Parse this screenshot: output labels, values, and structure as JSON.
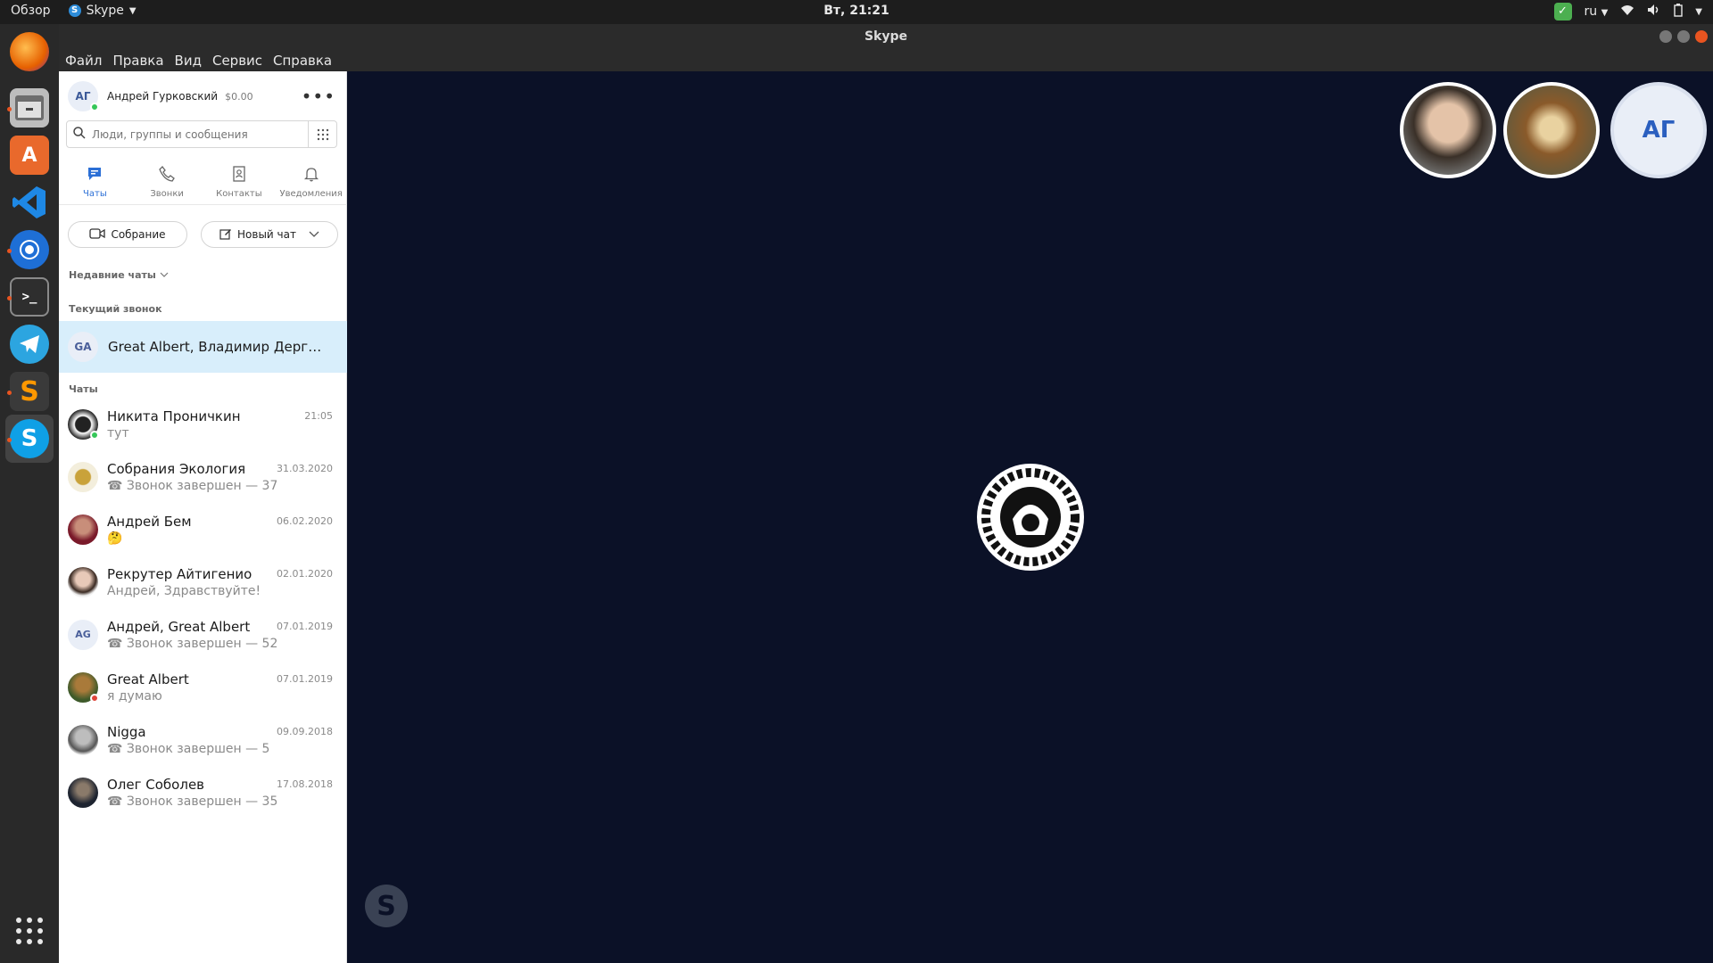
{
  "topbar": {
    "overview": "Обзор",
    "app_name": "Skype",
    "clock": "Вт, 21:21",
    "lang": "ru"
  },
  "window": {
    "title": "Skype"
  },
  "menu": [
    "Файл",
    "Правка",
    "Вид",
    "Сервис",
    "Справка"
  ],
  "profile": {
    "initials": "АГ",
    "name": "Андрей Гурковский",
    "balance": "$0.00"
  },
  "search": {
    "placeholder": "Люди, группы и сообщения"
  },
  "tabs": {
    "chats": "Чаты",
    "calls": "Звонки",
    "contacts": "Контакты",
    "notifications": "Уведомления"
  },
  "actions": {
    "meeting": "Собрание",
    "new_chat": "Новый чат"
  },
  "sections": {
    "recent": "Недавние чаты",
    "current_call": "Текущий звонок",
    "chats": "Чаты"
  },
  "current_call": {
    "initials": "GA",
    "name": "Great Albert, Владимир Дергачев, ..."
  },
  "chats": [
    {
      "name": "Никита Проничкин",
      "msg": "тут",
      "date": "21:05"
    },
    {
      "name": "Собрания Экология",
      "msg": "☎ Звонок завершен — 37",
      "date": "31.03.2020"
    },
    {
      "name": "Андрей Бем",
      "msg": "🤔",
      "date": "06.02.2020"
    },
    {
      "name": "Рекрутер Айтигенио",
      "msg": "Андрей, Здравствуйте!",
      "date": "02.01.2020"
    },
    {
      "name": "Андрей, Great Albert",
      "msg": "☎ Звонок завершен — 52",
      "date": "07.01.2019",
      "initials": "AG"
    },
    {
      "name": "Great Albert",
      "msg": "я думаю",
      "date": "07.01.2019"
    },
    {
      "name": "Nigga",
      "msg": "☎ Звонок завершен — 5",
      "date": "09.09.2018"
    },
    {
      "name": "Олег Соболев",
      "msg": "☎ Звонок завершен — 35",
      "date": "17.08.2018"
    }
  ],
  "participants": {
    "self_initials": "АГ"
  },
  "colors": {
    "accent": "#2b6fd6",
    "call_bg": "#0b1127",
    "active_row": "#d8eefb"
  }
}
